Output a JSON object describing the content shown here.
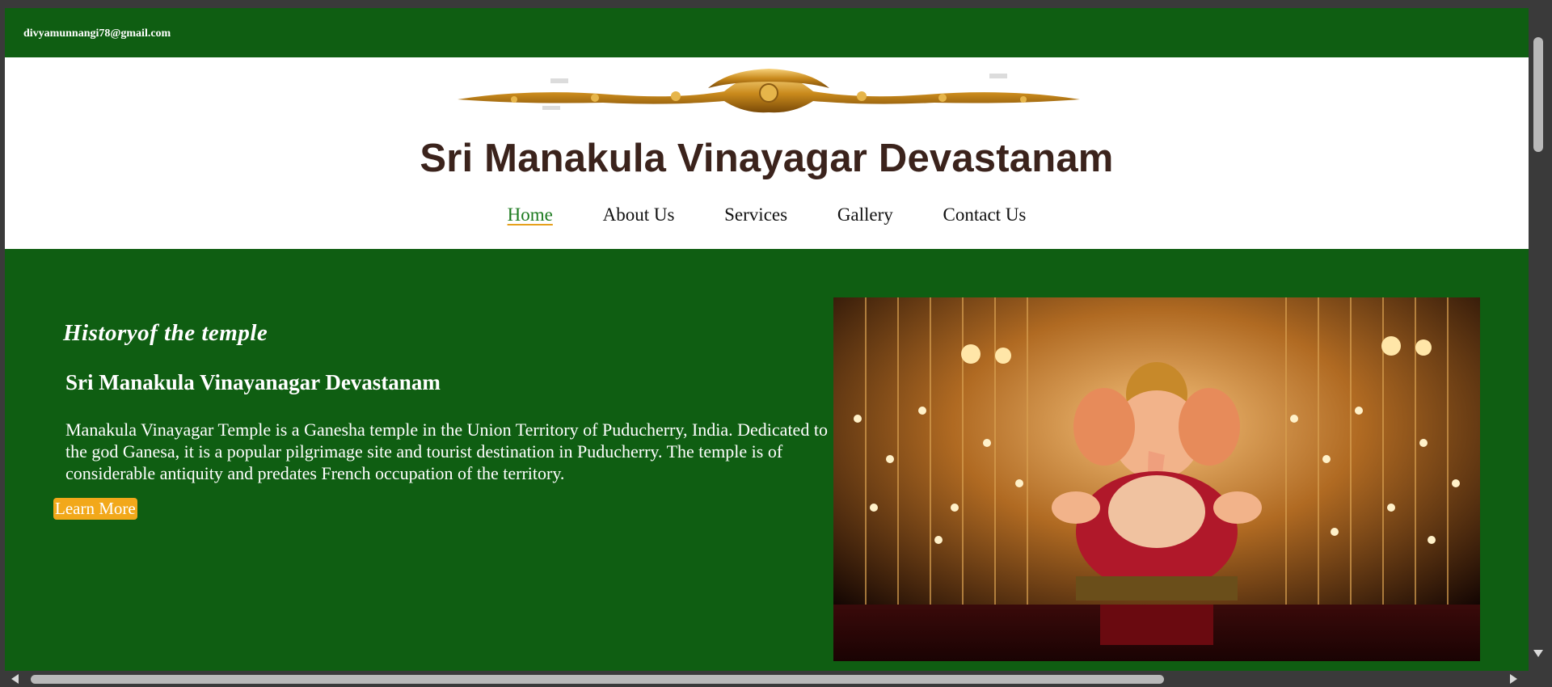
{
  "topbar": {
    "email": "divyamunnangi78@gmail.com"
  },
  "header": {
    "ornament_icon": "golden-scroll-ornament",
    "title": "Sri Manakula Vinayagar Devastanam"
  },
  "nav": {
    "items": [
      {
        "label": "Home",
        "active": true
      },
      {
        "label": "About Us",
        "active": false
      },
      {
        "label": "Services",
        "active": false
      },
      {
        "label": "Gallery",
        "active": false
      },
      {
        "label": "Contact Us",
        "active": false
      }
    ]
  },
  "hero": {
    "kicker": "Historyof the temple",
    "heading": "Sri Manakula Vinayanagar Devastanam",
    "paragraph": "Manakula Vinayagar Temple is a Ganesha temple in the Union Territory of Puducherry, India. Dedicated to the god Ganesa, it is a popular pilgrimage site and tourist destination in Puducherry. The temple is of considerable antiquity and predates French occupation of the territory.",
    "button_label": "Learn More",
    "image_subject": "ganesha-idol-photo"
  },
  "colors": {
    "primary_green": "#0f5e12",
    "title_brown": "#3b231c",
    "accent_orange": "#f2a81a",
    "active_link": "#1c7a1f"
  }
}
